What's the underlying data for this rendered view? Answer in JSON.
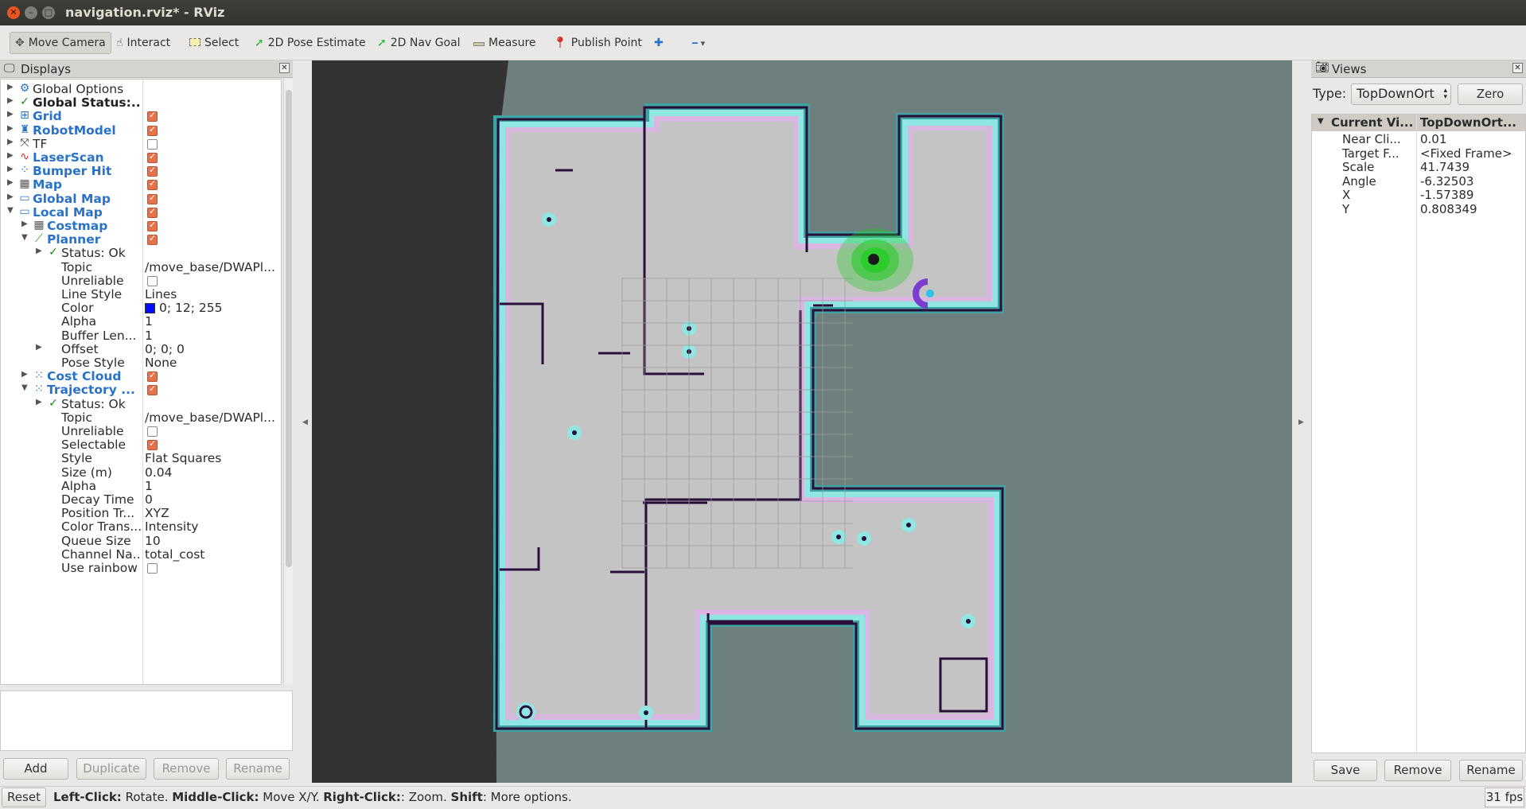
{
  "window": {
    "title": "navigation.rviz* - RViz",
    "close_glyph": "✕",
    "min_glyph": "–",
    "max_glyph": "□"
  },
  "toolbar": {
    "tools": [
      {
        "label": "Move Camera",
        "icon": "move-camera-icon",
        "active": true
      },
      {
        "label": "Interact",
        "icon": "interact-icon"
      },
      {
        "label": "Select",
        "icon": "select-icon"
      },
      {
        "label": "2D Pose Estimate",
        "icon": "pose-estimate-icon"
      },
      {
        "label": "2D Nav Goal",
        "icon": "nav-goal-icon"
      },
      {
        "label": "Measure",
        "icon": "measure-icon"
      },
      {
        "label": "Publish Point",
        "icon": "publish-point-icon"
      }
    ],
    "add_tool_glyph": "✚",
    "remove_tool_glyph": "━",
    "remove_tool_dropdown": "▾"
  },
  "displays": {
    "title": "Displays",
    "rows": [
      {
        "label": "Global Options",
        "icon": "global-options-icon",
        "style": "plain",
        "depth": 0,
        "expander": "▶"
      },
      {
        "label": "Global Status:...",
        "icon": "status-ok-icon",
        "style": "black",
        "depth": 0,
        "expander": "▶"
      },
      {
        "label": "Grid",
        "icon": "grid-icon",
        "style": "blue",
        "depth": 0,
        "expander": "▶",
        "checked": true
      },
      {
        "label": "RobotModel",
        "icon": "robot-model-icon",
        "style": "blue",
        "depth": 0,
        "expander": "▶",
        "checked": true
      },
      {
        "label": "TF",
        "icon": "tf-icon",
        "style": "plain",
        "depth": 0,
        "expander": "▶",
        "checked": false
      },
      {
        "label": "LaserScan",
        "icon": "laser-scan-icon",
        "style": "blue",
        "depth": 0,
        "expander": "▶",
        "checked": true
      },
      {
        "label": "Bumper Hit",
        "icon": "bumper-hit-icon",
        "style": "blue",
        "depth": 0,
        "expander": "▶",
        "checked": true
      },
      {
        "label": "Map",
        "icon": "map-icon",
        "style": "blue",
        "depth": 0,
        "expander": "▶",
        "checked": true
      },
      {
        "label": "Global Map",
        "icon": "folder-icon",
        "style": "blue",
        "depth": 0,
        "expander": "▶",
        "checked": true
      },
      {
        "label": "Local Map",
        "icon": "folder-icon",
        "style": "blue",
        "depth": 0,
        "expander": "▼",
        "checked": true
      },
      {
        "label": "Costmap",
        "icon": "map-icon",
        "style": "blue",
        "depth": 1,
        "expander": "▶",
        "checked": true
      },
      {
        "label": "Planner",
        "icon": "path-icon",
        "style": "blue",
        "depth": 1,
        "expander": "▼",
        "checked": true
      },
      {
        "label": "Status: Ok",
        "icon": "status-ok-icon",
        "style": "plain",
        "depth": 2,
        "expander": "▶"
      },
      {
        "label": "Topic",
        "value": "/move_base/DWAPl...",
        "style": "plain",
        "depth": 2
      },
      {
        "label": "Unreliable",
        "style": "plain",
        "depth": 2,
        "checked": false
      },
      {
        "label": "Line Style",
        "value": "Lines",
        "style": "plain",
        "depth": 2
      },
      {
        "label": "Color",
        "value": "0; 12; 255",
        "swatch": "#000cff",
        "style": "plain",
        "depth": 2
      },
      {
        "label": "Alpha",
        "value": "1",
        "style": "plain",
        "depth": 2
      },
      {
        "label": "Buffer Len...",
        "value": "1",
        "style": "plain",
        "depth": 2
      },
      {
        "label": "Offset",
        "value": "0; 0; 0",
        "style": "plain",
        "depth": 2,
        "expander": "▶"
      },
      {
        "label": "Pose Style",
        "value": "None",
        "style": "plain",
        "depth": 2
      },
      {
        "label": "Cost Cloud",
        "icon": "point-cloud-icon",
        "style": "blue",
        "depth": 1,
        "expander": "▶",
        "checked": true
      },
      {
        "label": "Trajectory ...",
        "icon": "point-cloud-icon",
        "style": "blue",
        "depth": 1,
        "expander": "▼",
        "checked": true
      },
      {
        "label": "Status: Ok",
        "icon": "status-ok-icon",
        "style": "plain",
        "depth": 2,
        "expander": "▶"
      },
      {
        "label": "Topic",
        "value": "/move_base/DWAPl...",
        "style": "plain",
        "depth": 2
      },
      {
        "label": "Unreliable",
        "style": "plain",
        "depth": 2,
        "checked": false
      },
      {
        "label": "Selectable",
        "style": "plain",
        "depth": 2,
        "checked": true
      },
      {
        "label": "Style",
        "value": "Flat Squares",
        "style": "plain",
        "depth": 2
      },
      {
        "label": "Size (m)",
        "value": "0.04",
        "style": "plain",
        "depth": 2
      },
      {
        "label": "Alpha",
        "value": "1",
        "style": "plain",
        "depth": 2
      },
      {
        "label": "Decay Time",
        "value": "0",
        "style": "plain",
        "depth": 2
      },
      {
        "label": "Position Tr...",
        "value": "XYZ",
        "style": "plain",
        "depth": 2
      },
      {
        "label": "Color Trans...",
        "value": "Intensity",
        "style": "plain",
        "depth": 2
      },
      {
        "label": "Queue Size",
        "value": "10",
        "style": "plain",
        "depth": 2
      },
      {
        "label": "Channel Na...",
        "value": "total_cost",
        "style": "plain",
        "depth": 2
      },
      {
        "label": "Use rainbow",
        "style": "plain",
        "depth": 2,
        "checked": false
      }
    ],
    "buttons": {
      "add": "Add",
      "duplicate": "Duplicate",
      "remove": "Remove",
      "rename": "Rename"
    }
  },
  "views": {
    "title": "Views",
    "type_label": "Type:",
    "type_value": "TopDownOrt",
    "zero_label": "Zero",
    "header": {
      "name": "Current Vi...",
      "value": "TopDownOrt..."
    },
    "props": [
      {
        "name": "Near Cli...",
        "value": "0.01"
      },
      {
        "name": "Target F...",
        "value": "<Fixed Frame>"
      },
      {
        "name": "Scale",
        "value": "41.7439"
      },
      {
        "name": "Angle",
        "value": "-6.32503"
      },
      {
        "name": "X",
        "value": "-1.57389"
      },
      {
        "name": "Y",
        "value": "0.808349"
      }
    ],
    "buttons": {
      "save": "Save",
      "remove": "Remove",
      "rename": "Rename"
    }
  },
  "status": {
    "reset": "Reset",
    "hint_parts": [
      {
        "text": "Left-Click:",
        "bold": true
      },
      {
        "text": " Rotate. ",
        "bold": false
      },
      {
        "text": "Middle-Click:",
        "bold": true
      },
      {
        "text": " Move X/Y. ",
        "bold": false
      },
      {
        "text": "Right-Click:",
        "bold": true
      },
      {
        "text": ": Zoom. ",
        "bold": false
      },
      {
        "text": "Shift",
        "bold": true
      },
      {
        "text": ": More options.",
        "bold": false
      }
    ],
    "fps": "31 fps"
  },
  "colors": {
    "map_free": "#c4c4c4",
    "map_background": "#6e807d",
    "wall": "#2a0f3a",
    "inflation_cyan": "#8fe6e3",
    "inflation_pink": "#d9b6e0",
    "costmap_teal": "#3fa3a3",
    "particles": "#22cc22",
    "checkbox_on": "#e5734a",
    "link_blue": "#2a72c8"
  }
}
